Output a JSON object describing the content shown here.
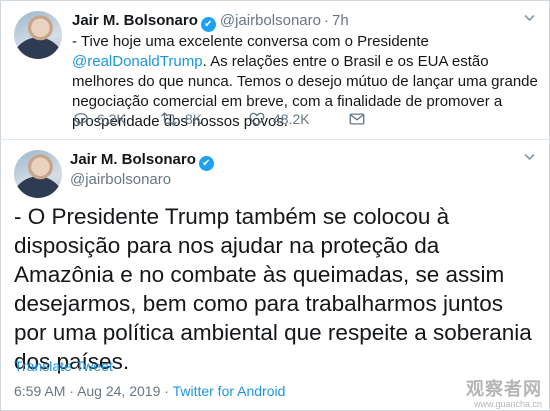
{
  "tweet1": {
    "author_name": "Jair M. Bolsonaro",
    "verified_mark": "✔",
    "handle": "@jairbolsonaro",
    "separator": "·",
    "time": "7h",
    "text_before_mention": "- Tive hoje uma excelente conversa com o Presidente ",
    "mention": "@realDonaldTrump",
    "text_after_mention": ". As relações entre o Brasil e os EUA estão melhores do que nunca. Temos o desejo mútuo de lançar uma grande negociação comercial em breve, com a finalidade de promover a prosperidade dos nossos povos.",
    "counts": {
      "replies": "6.2K",
      "retweets": "8K",
      "likes": "48.2K"
    },
    "icons": [
      "reply-icon",
      "retweet-icon",
      "heart-icon",
      "envelope-icon",
      "chevron-down-icon"
    ]
  },
  "tweet2": {
    "author_name": "Jair M. Bolsonaro",
    "verified_mark": "✔",
    "handle": "@jairbolsonaro",
    "text": "- O Presidente Trump também se colocou à disposição para nos ajudar na proteção da Amazônia e no combate às queimadas, se assim desejarmos, bem como para trabalharmos juntos por uma política ambiental que respeite a soberania dos países.",
    "translate_label": "Translate Tweet",
    "time": "6:59 AM",
    "date": "Aug 24, 2019",
    "separator": "·",
    "source": "Twitter for Android"
  },
  "watermark": {
    "chinese": "观察者网",
    "url": "www.guancha.cn"
  },
  "colors": {
    "link": "#1b95e0",
    "secondary": "#657786",
    "verified": "#1da1f2",
    "text": "#14171a"
  }
}
